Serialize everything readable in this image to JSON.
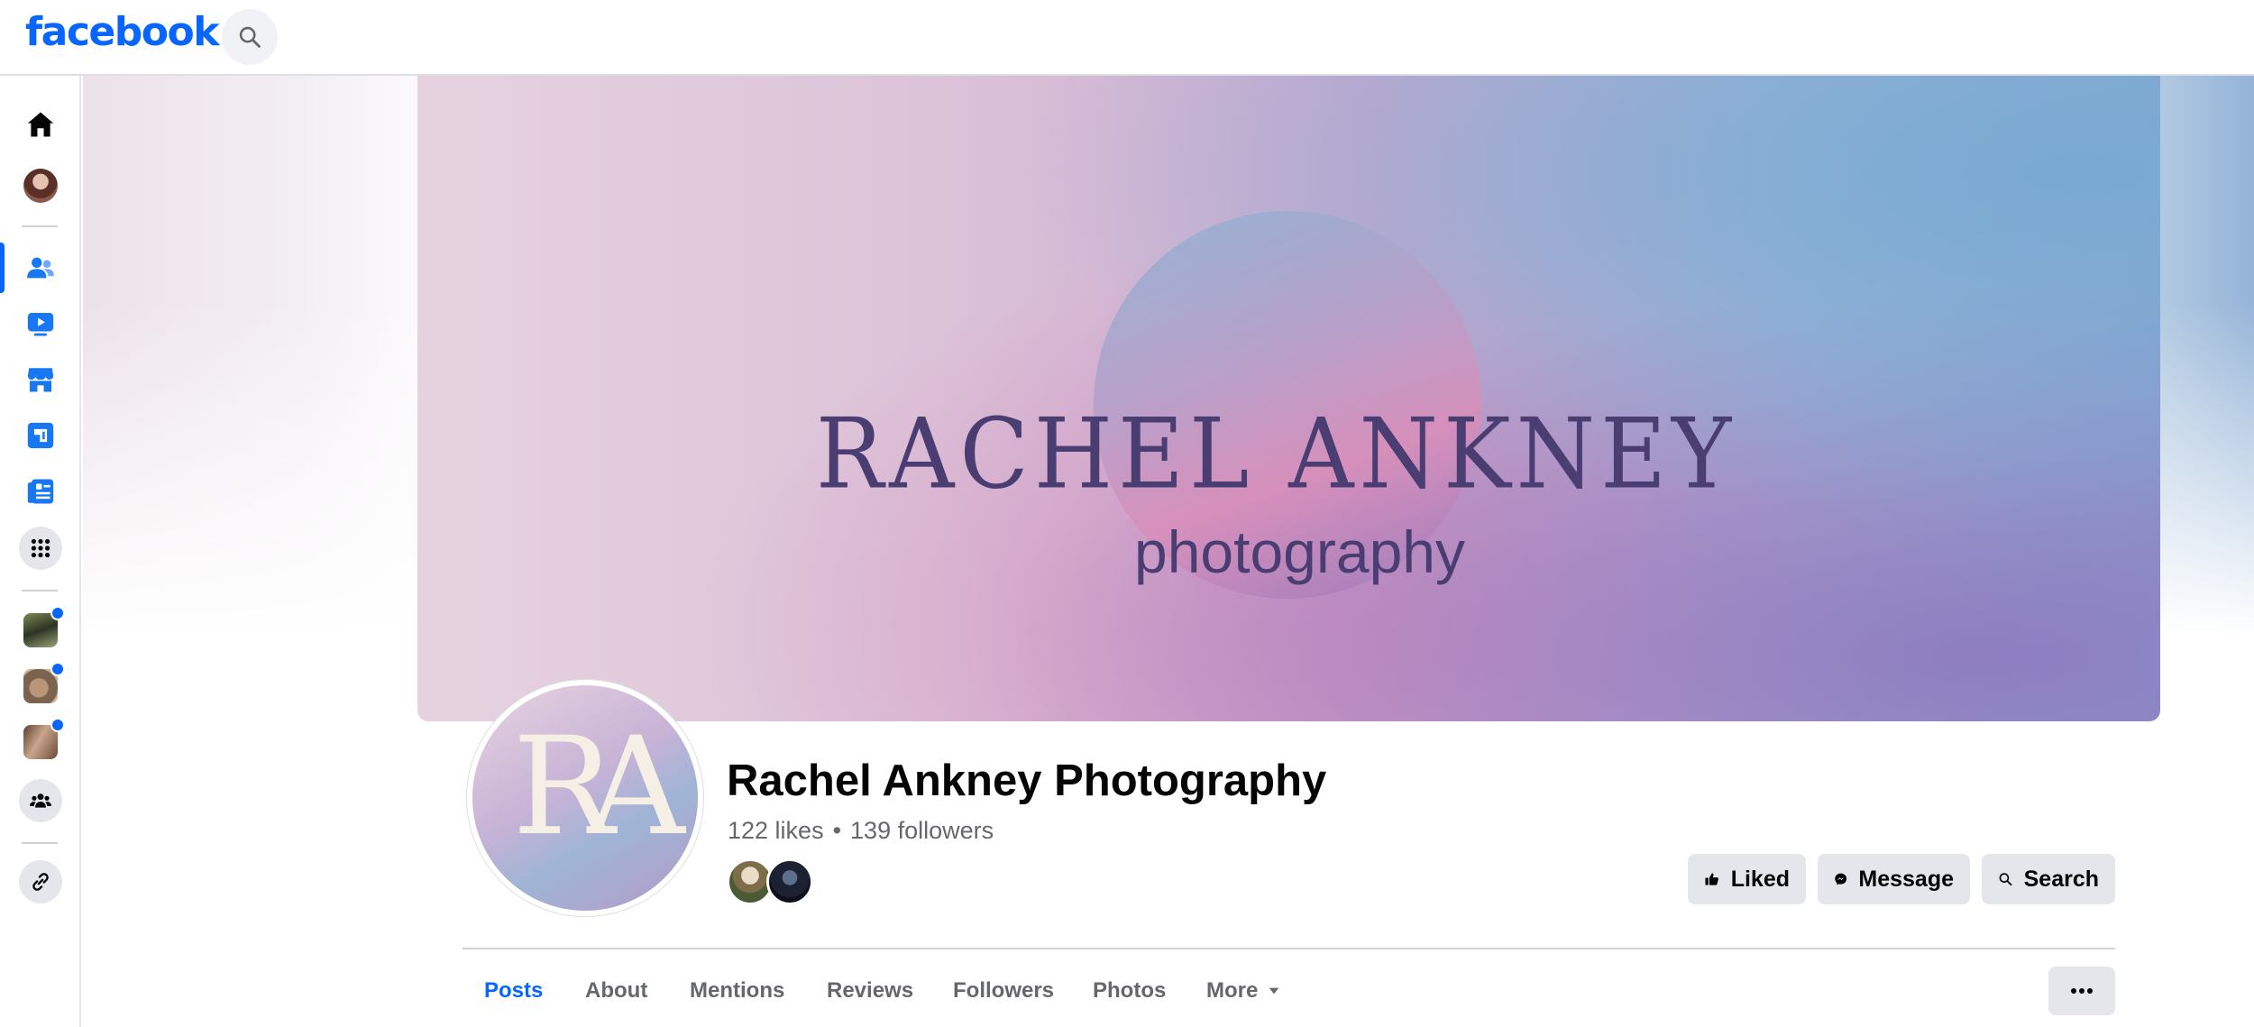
{
  "brand": {
    "logo_text": "facebook",
    "color": "#0866ff"
  },
  "topbar": {
    "search_icon": "search-icon"
  },
  "rail": {
    "items": [
      {
        "name": "home",
        "icon": "home-icon"
      },
      {
        "name": "profile",
        "icon": "avatar"
      },
      {
        "name": "friends",
        "icon": "friends-icon",
        "active": true
      },
      {
        "name": "watch",
        "icon": "video-icon"
      },
      {
        "name": "marketplace",
        "icon": "store-icon"
      },
      {
        "name": "feeds",
        "icon": "feeds-icon"
      },
      {
        "name": "pages",
        "icon": "pages-icon"
      },
      {
        "name": "menu",
        "icon": "grid-menu-icon"
      },
      {
        "name": "shortcut-1",
        "icon": "shortcut-avatar"
      },
      {
        "name": "shortcut-2",
        "icon": "shortcut-avatar"
      },
      {
        "name": "shortcut-3",
        "icon": "shortcut-avatar"
      },
      {
        "name": "groups",
        "icon": "groups-icon"
      },
      {
        "name": "link",
        "icon": "link-icon"
      }
    ]
  },
  "cover": {
    "title": "RACHEL ANKNEY",
    "subtitle": "photography"
  },
  "profile": {
    "monogram": "RA",
    "name": "Rachel Ankney Photography",
    "likes": "122 likes",
    "separator": "•",
    "followers": "139 followers"
  },
  "actions": {
    "liked": "Liked",
    "message": "Message",
    "search": "Search"
  },
  "tabs": [
    "Posts",
    "About",
    "Mentions",
    "Reviews",
    "Followers",
    "Photos",
    "More"
  ],
  "active_tab": "Posts"
}
